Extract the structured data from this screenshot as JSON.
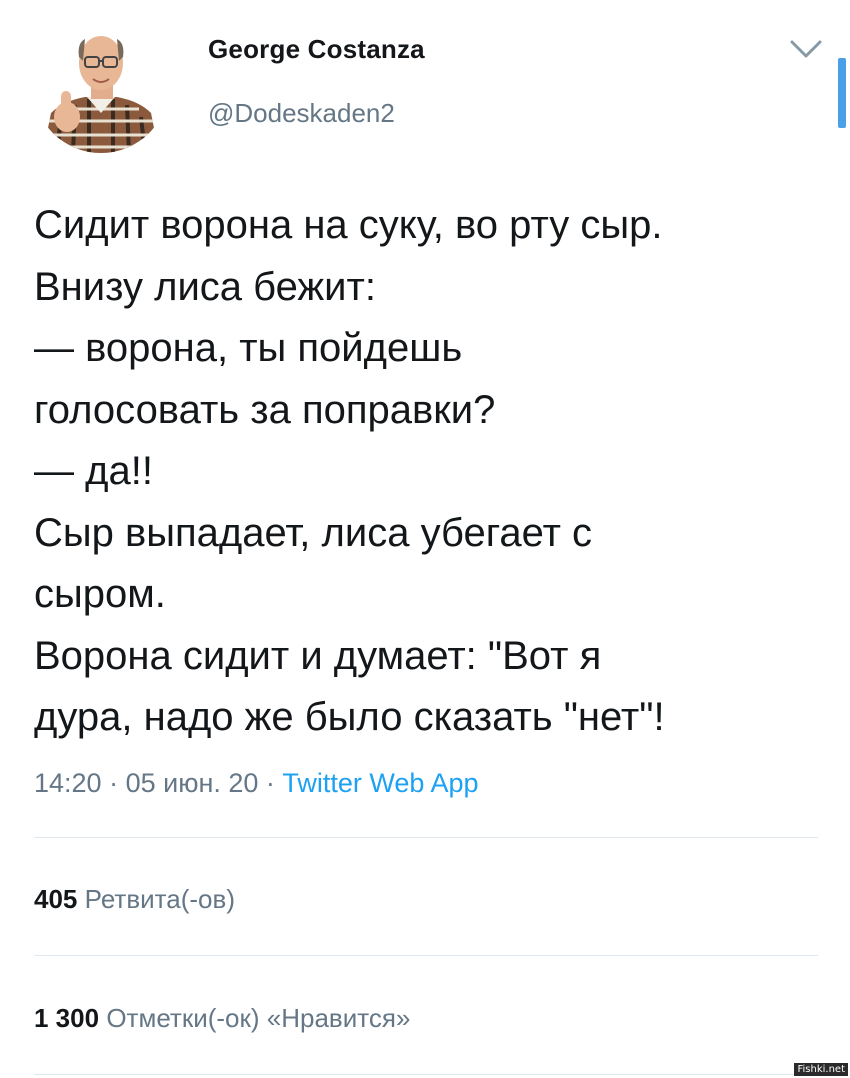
{
  "author": {
    "display_name": "George Costanza",
    "handle": "@Dodeskaden2"
  },
  "tweet": {
    "lines": [
      "Сидит ворона на суку, во рту сыр.",
      "Внизу лиса бежит:",
      "— ворона, ты пойдешь",
      "голосовать за поправки?",
      "— да!!",
      "Сыр выпадает, лиса убегает с",
      "сыром.",
      "Ворона сидит и думает: \"Вот я",
      "дура, надо же было сказать \"нет\"!"
    ],
    "time": "14:20",
    "date": "05 июн. 20",
    "separator": " · ",
    "source": "Twitter Web App"
  },
  "stats": {
    "retweets_count": "405",
    "retweets_label": "Ретвита(-ов)",
    "likes_count": "1 300",
    "likes_label": "Отметки(-ок) «Нравится»"
  },
  "watermark": "Fishki.net",
  "colors": {
    "text": "#14171a",
    "secondary": "#657786",
    "link": "#1da1f2",
    "divider": "#e1e8ed",
    "scroll_indicator": "#4aa0e8"
  },
  "icons": {
    "menu": "chevron-down-icon"
  }
}
